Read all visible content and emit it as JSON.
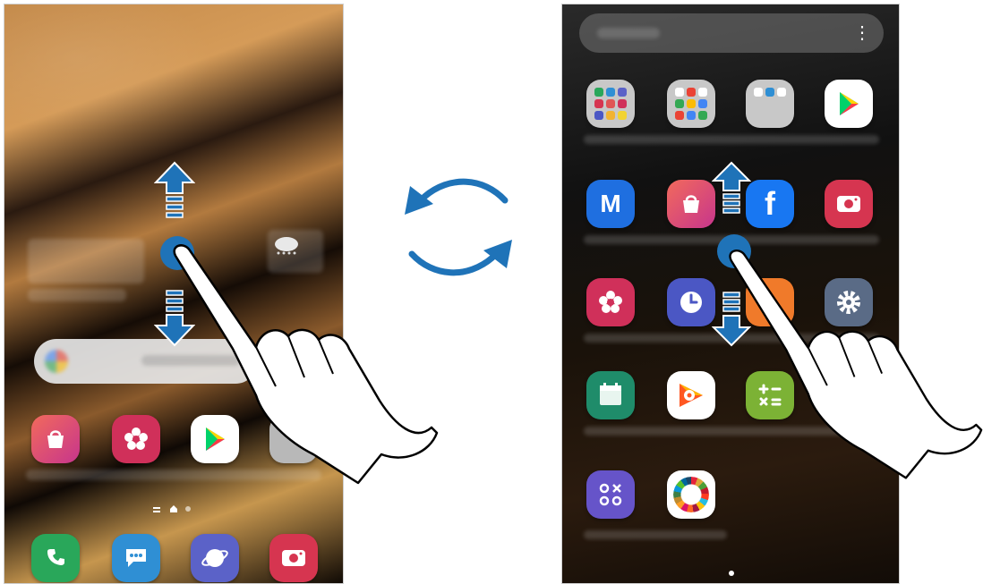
{
  "home_screen": {
    "dock_apps": [
      {
        "name": "phone-icon",
        "color": "#29a75a"
      },
      {
        "name": "messages-icon",
        "color": "#2f8fd4"
      },
      {
        "name": "internet-icon",
        "color": "#5b62c8"
      },
      {
        "name": "camera-icon",
        "color": "#d63550"
      }
    ],
    "home_apps": [
      {
        "name": "galaxy-store-icon",
        "color": "#d9348f"
      },
      {
        "name": "gallery-icon",
        "color": "#d0305a"
      },
      {
        "name": "play-store-icon",
        "color": "#ffffff"
      },
      {
        "name": "folder-icon",
        "color": "#b8b8b8"
      }
    ]
  },
  "apps_screen": {
    "more_options_glyph": "⋮",
    "rows": [
      [
        {
          "name": "samsung-folder-icon",
          "color": "#c8c8c8"
        },
        {
          "name": "google-folder-icon",
          "color": "#c8c8c8"
        },
        {
          "name": "microsoft-folder-icon",
          "color": "#c8c8c8"
        },
        {
          "name": "play-store-icon",
          "color": "#ffffff"
        }
      ],
      [
        {
          "name": "samsung-members-icon",
          "color": "#1f6fe0"
        },
        {
          "name": "galaxy-store-icon",
          "color": "#d9348f"
        },
        {
          "name": "facebook-icon",
          "color": "#1877f2"
        },
        {
          "name": "camera-icon",
          "color": "#d63550"
        }
      ],
      [
        {
          "name": "gallery-icon",
          "color": "#d0305a"
        },
        {
          "name": "clock-icon",
          "color": "#4b57c4"
        },
        {
          "name": "orange-app-icon",
          "color": "#f07a2a"
        },
        {
          "name": "settings-icon",
          "color": "#5a6b86"
        }
      ],
      [
        {
          "name": "calendar-icon",
          "color": "#1f8c6a"
        },
        {
          "name": "play-music-icon",
          "color": "#ffffff"
        },
        {
          "name": "calculator-icon",
          "color": "#7cb235"
        },
        {
          "name": "empty-slot",
          "color": "transparent"
        }
      ],
      [
        {
          "name": "game-launcher-icon",
          "color": "#6654c9"
        },
        {
          "name": "sdg-icon",
          "color": "#ffffff"
        },
        {
          "name": "empty-slot",
          "color": "transparent"
        },
        {
          "name": "empty-slot",
          "color": "transparent"
        }
      ]
    ]
  },
  "gesture": {
    "accent_color": "#1f73b8"
  }
}
